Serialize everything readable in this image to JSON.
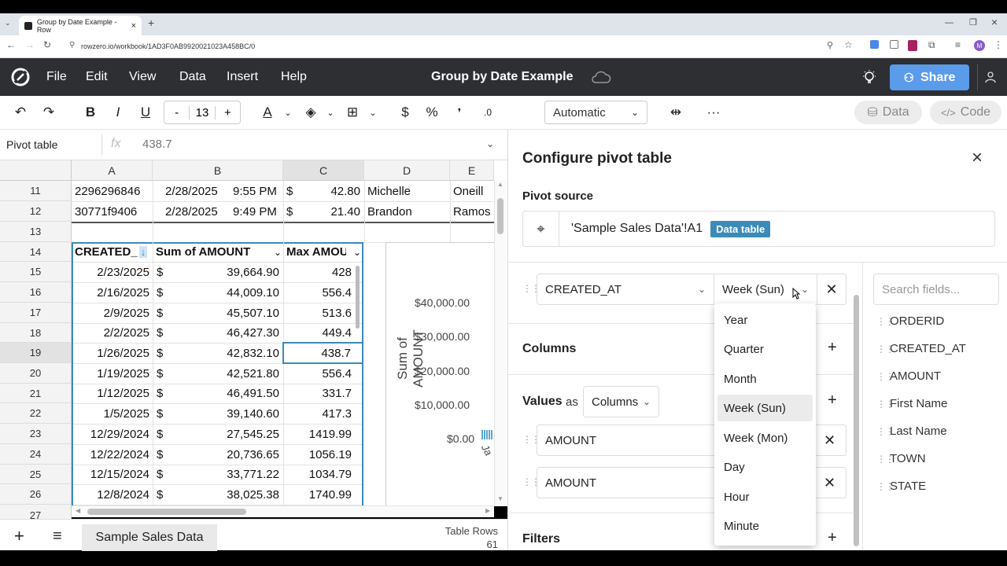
{
  "browser": {
    "tab_title": "Group by Date Example - Row",
    "url": "rowzero.io/workbook/1AD3F0AB9920021023A458BC/0"
  },
  "app": {
    "menu": [
      "File",
      "Edit",
      "View",
      "Data",
      "Insert",
      "Help"
    ],
    "title": "Group by Date Example",
    "share_label": "Share"
  },
  "toolbar": {
    "font_minus": "-",
    "font_size": "13",
    "font_plus": "+",
    "number_format": "Automatic",
    "more": "···",
    "data_label": "Data",
    "code_label": "Code"
  },
  "formula_bar": {
    "name_box": "Pivot table",
    "fx": "fx",
    "value": "438.7"
  },
  "grid": {
    "columns": [
      "A",
      "B",
      "C",
      "D",
      "E"
    ],
    "rows": [
      "11",
      "12",
      "13",
      "14",
      "15",
      "16",
      "17",
      "18",
      "19",
      "20",
      "21",
      "22",
      "23",
      "24",
      "25",
      "26",
      "27"
    ],
    "data_rows": [
      {
        "a": "2296296846",
        "b": "2/28/2025",
        "b2": "9:55 PM",
        "c_sym": "$",
        "c": "42.80",
        "d": "Michelle",
        "e": "Oneill"
      },
      {
        "a": "30771f9406",
        "b": "2/28/2025",
        "b2": "9:49 PM",
        "c_sym": "$",
        "c": "21.40",
        "d": "Brandon",
        "e": "Ramos"
      }
    ],
    "pivot_headers": [
      "CREATED_",
      "Sum of AMOUNT",
      "Max AMOU"
    ],
    "pivot_rows": [
      {
        "date": "2/23/2025",
        "sym": "$",
        "sum": "39,664.90",
        "max": "428"
      },
      {
        "date": "2/16/2025",
        "sym": "$",
        "sum": "44,009.10",
        "max": "556.4"
      },
      {
        "date": "2/9/2025",
        "sym": "$",
        "sum": "45,507.10",
        "max": "513.6"
      },
      {
        "date": "2/2/2025",
        "sym": "$",
        "sum": "46,427.30",
        "max": "449.4"
      },
      {
        "date": "1/26/2025",
        "sym": "$",
        "sum": "42,832.10",
        "max": "438.7"
      },
      {
        "date": "1/19/2025",
        "sym": "$",
        "sum": "42,521.80",
        "max": "556.4"
      },
      {
        "date": "1/12/2025",
        "sym": "$",
        "sum": "46,491.50",
        "max": "331.7"
      },
      {
        "date": "1/5/2025",
        "sym": "$",
        "sum": "39,140.60",
        "max": "417.3"
      },
      {
        "date": "12/29/2024",
        "sym": "$",
        "sum": "27,545.25",
        "max": "1419.99"
      },
      {
        "date": "12/22/2024",
        "sym": "$",
        "sum": "20,736.65",
        "max": "1056.19"
      },
      {
        "date": "12/15/2024",
        "sym": "$",
        "sum": "33,771.22",
        "max": "1034.79"
      },
      {
        "date": "12/8/2024",
        "sym": "$",
        "sum": "38,025.38",
        "max": "1740.99"
      }
    ],
    "chart": {
      "ylabel": "Sum of AMOUNT",
      "ticks": [
        "$40,000.00",
        "$30,000.00",
        "$20,000.00",
        "$10,000.00",
        "$0.00"
      ],
      "xtick": "Ja"
    }
  },
  "bottom": {
    "sheet_tab": "Sample Sales Data",
    "table_rows_label": "Table Rows",
    "table_rows_value": "61"
  },
  "panel": {
    "title": "Configure pivot table",
    "pivot_source_label": "Pivot source",
    "pivot_source_value": "'Sample Sales Data'!A1",
    "pivot_source_badge": "Data table",
    "row_field": "CREATED_AT",
    "group_by": "Week (Sun)",
    "columns_label": "Columns",
    "values_label": "Values",
    "values_as": "as",
    "values_mode": "Columns",
    "value_fields": [
      "AMOUNT",
      "AMOUNT"
    ],
    "filters_label": "Filters",
    "search_placeholder": "Search fields...",
    "fields": [
      "ORDERID",
      "CREATED_AT",
      "AMOUNT",
      "First Name",
      "Last Name",
      "TOWN",
      "STATE"
    ],
    "group_options": [
      "Year",
      "Quarter",
      "Month",
      "Week (Sun)",
      "Week (Mon)",
      "Day",
      "Hour",
      "Minute"
    ],
    "selected_option": "Week (Sun)"
  },
  "colors": {
    "header_bg": "#2d2f33",
    "share_bg": "#5a9bea",
    "pivot_border": "#3b8bb8",
    "badge_bg": "#3b8bb8"
  }
}
